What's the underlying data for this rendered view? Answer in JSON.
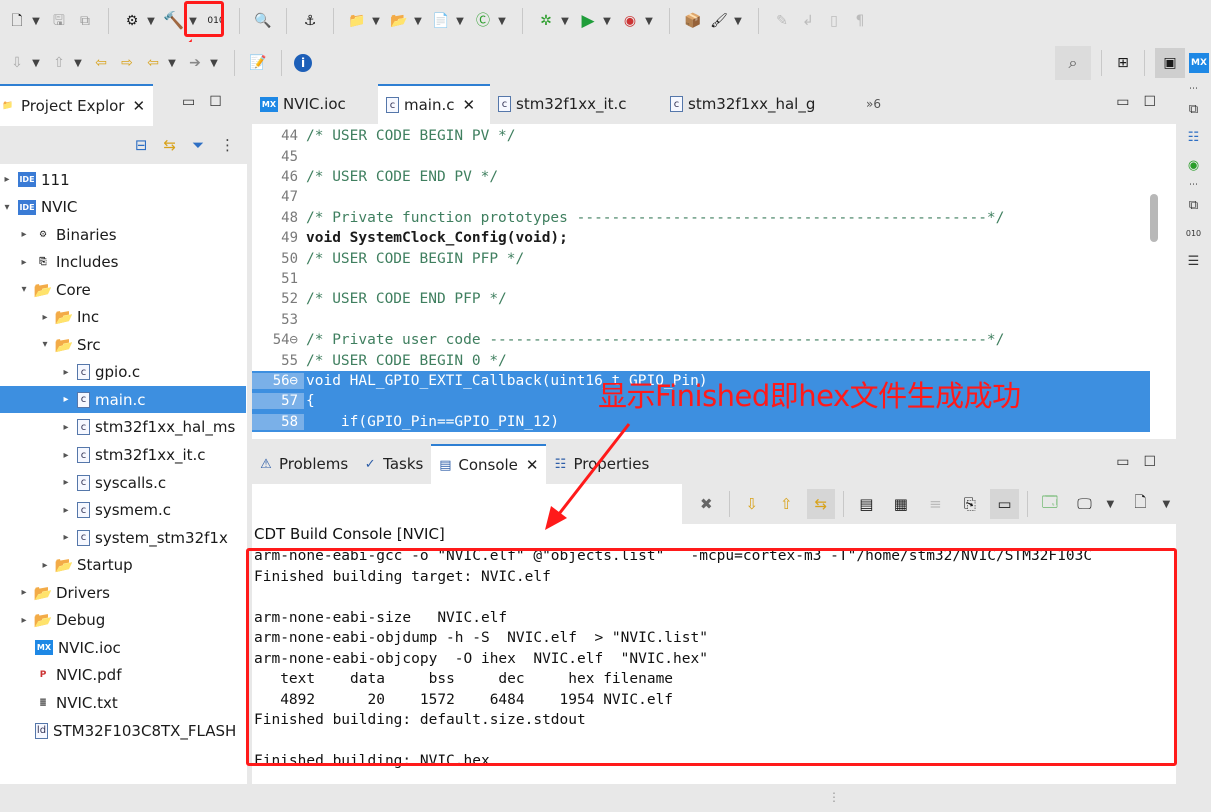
{
  "annotation": {
    "text": "显示Finished即hex文件生成成功"
  },
  "project_explorer": {
    "tab_label": "Project Explor",
    "tree": [
      {
        "label": "111",
        "icon": "ide-project-icon",
        "depth": 0,
        "twisty": "▸"
      },
      {
        "label": "NVIC",
        "icon": "ide-project-icon",
        "depth": 0,
        "twisty": "▾"
      },
      {
        "label": "Binaries",
        "icon": "binaries-icon",
        "depth": 1,
        "twisty": "▸"
      },
      {
        "label": "Includes",
        "icon": "includes-icon",
        "depth": 1,
        "twisty": "▸"
      },
      {
        "label": "Core",
        "icon": "folder-icon",
        "depth": 1,
        "twisty": "▾"
      },
      {
        "label": "Inc",
        "icon": "folder-icon",
        "depth": 2,
        "twisty": "▸"
      },
      {
        "label": "Src",
        "icon": "folder-icon",
        "depth": 2,
        "twisty": "▾"
      },
      {
        "label": "gpio.c",
        "icon": "c-file-icon",
        "depth": 3,
        "twisty": "▸"
      },
      {
        "label": "main.c",
        "icon": "c-file-icon",
        "depth": 3,
        "twisty": "▸",
        "selected": true
      },
      {
        "label": "stm32f1xx_hal_ms",
        "icon": "c-file-icon",
        "depth": 3,
        "twisty": "▸"
      },
      {
        "label": "stm32f1xx_it.c",
        "icon": "c-file-icon",
        "depth": 3,
        "twisty": "▸"
      },
      {
        "label": "syscalls.c",
        "icon": "c-file-icon",
        "depth": 3,
        "twisty": "▸"
      },
      {
        "label": "sysmem.c",
        "icon": "c-file-icon",
        "depth": 3,
        "twisty": "▸"
      },
      {
        "label": "system_stm32f1x",
        "icon": "c-file-icon",
        "depth": 3,
        "twisty": "▸"
      },
      {
        "label": "Startup",
        "icon": "folder-icon",
        "depth": 2,
        "twisty": "▸"
      },
      {
        "label": "Drivers",
        "icon": "folder-icon",
        "depth": 1,
        "twisty": "▸"
      },
      {
        "label": "Debug",
        "icon": "folder-icon",
        "depth": 1,
        "twisty": "▸"
      },
      {
        "label": "NVIC.ioc",
        "icon": "mx-file-icon",
        "depth": 1,
        "twisty": ""
      },
      {
        "label": "NVIC.pdf",
        "icon": "pdf-file-icon",
        "depth": 1,
        "twisty": ""
      },
      {
        "label": "NVIC.txt",
        "icon": "text-file-icon",
        "depth": 1,
        "twisty": ""
      },
      {
        "label": "STM32F103C8TX_FLASH",
        "icon": "linker-file-icon",
        "depth": 1,
        "twisty": ""
      }
    ]
  },
  "editor": {
    "tabs": [
      {
        "label": "NVIC.ioc",
        "icon": "mx-file-icon"
      },
      {
        "label": "main.c",
        "icon": "c-file-icon",
        "active": true,
        "closable": true
      },
      {
        "label": "stm32f1xx_it.c",
        "icon": "c-file-icon"
      },
      {
        "label": "stm32f1xx_hal_g",
        "icon": "c-file-icon"
      }
    ],
    "overflow_label": "»6",
    "lines": [
      {
        "n": "44",
        "text": "/* USER CODE BEGIN PV */",
        "kind": "comment"
      },
      {
        "n": "45",
        "text": "",
        "kind": "plain"
      },
      {
        "n": "46",
        "text": "/* USER CODE END PV */",
        "kind": "comment"
      },
      {
        "n": "47",
        "text": "",
        "kind": "plain"
      },
      {
        "n": "48",
        "text": "/* Private function prototypes -----------------------------------------------*/",
        "kind": "comment"
      },
      {
        "n": "49",
        "text": "void SystemClock_Config(void);",
        "kind": "decl"
      },
      {
        "n": "50",
        "text": "/* USER CODE BEGIN PFP */",
        "kind": "comment"
      },
      {
        "n": "51",
        "text": "",
        "kind": "plain"
      },
      {
        "n": "52",
        "text": "/* USER CODE END PFP */",
        "kind": "comment"
      },
      {
        "n": "53",
        "text": "",
        "kind": "plain"
      },
      {
        "n": "54⊖",
        "text": "/* Private user code ---------------------------------------------------------*/",
        "kind": "comment"
      },
      {
        "n": "55",
        "text": "/* USER CODE BEGIN 0 */",
        "kind": "comment"
      },
      {
        "n": "56⊖",
        "text": "void HAL_GPIO_EXTI_Callback(uint16_t GPIO_Pin)",
        "kind": "hl"
      },
      {
        "n": "57",
        "text": "{",
        "kind": "hl"
      },
      {
        "n": "58",
        "text": "    if(GPIO_Pin==GPIO_PIN_12)",
        "kind": "hl"
      }
    ]
  },
  "bottom": {
    "tabs": [
      {
        "label": "Problems",
        "icon": "problems-icon"
      },
      {
        "label": "Tasks",
        "icon": "tasks-icon"
      },
      {
        "label": "Console",
        "icon": "console-icon",
        "active": true,
        "closable": true
      },
      {
        "label": "Properties",
        "icon": "properties-icon"
      }
    ],
    "console_title": "CDT Build Console [NVIC]",
    "console_lines": [
      "arm-none-eabi-gcc -o \"NVIC.elf\" @\"objects.list\"   -mcpu=cortex-m3 -T\"/home/stm32/NVIC/STM32F103C",
      "Finished building target: NVIC.elf",
      "",
      "arm-none-eabi-size   NVIC.elf",
      "arm-none-eabi-objdump -h -S  NVIC.elf  > \"NVIC.list\"",
      "arm-none-eabi-objcopy  -O ihex  NVIC.elf  \"NVIC.hex\"",
      "   text\t   data\t    bss\t    dec\t    hex\tfilename",
      "   4892\t     20\t   1572\t   6484\t   1954\tNVIC.elf",
      "Finished building: default.size.stdout",
      "",
      "Finished building: NVIC.hex"
    ]
  },
  "colors": {
    "accent": "#3d8fe0",
    "annotation": "#ff1a1a"
  }
}
